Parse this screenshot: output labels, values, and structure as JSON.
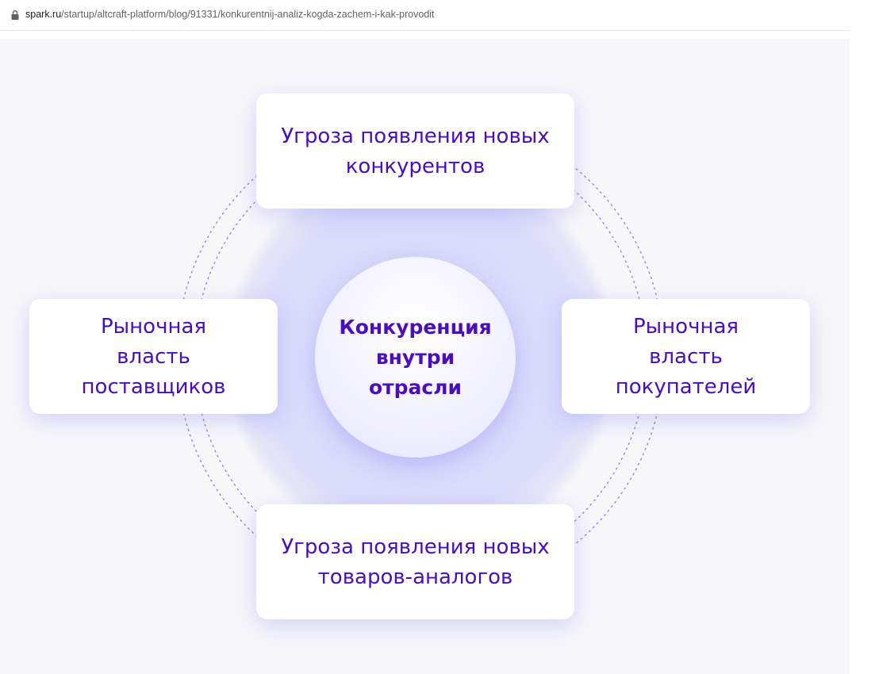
{
  "browser": {
    "url_host": "spark.ru",
    "url_path": "/startup/altcraft-platform/blog/91331/konkurentnij-analiz-kogda-zachem-i-kak-provodit"
  },
  "diagram": {
    "center": "Конкуренция\nвнутри\nотрасли",
    "top": "Угроза появления новых\nконкурентов",
    "left": "Рыночная\nвласть\nпоставщиков",
    "right": "Рыночная\nвласть\nпокупателей",
    "bottom": "Угроза появления новых\nтоваров-аналогов"
  },
  "colors": {
    "text": "#4a0fb8",
    "background": "#f7f7fa",
    "accent_ring": "#8c7df0",
    "halo": "#d4d3fb"
  }
}
